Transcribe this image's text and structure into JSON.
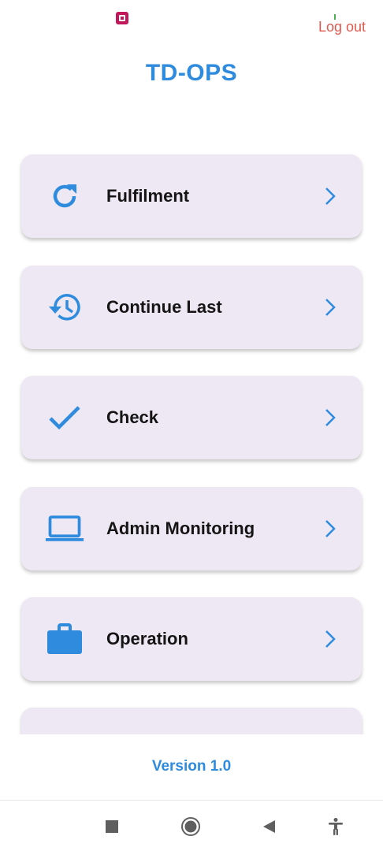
{
  "status_bar": {
    "app_icon": "notification-app-icon"
  },
  "header": {
    "logout_label": "Log out",
    "title": "TD-OPS"
  },
  "menu": {
    "items": [
      {
        "label": "Fulfilment",
        "icon": "refresh-icon"
      },
      {
        "label": "Continue Last",
        "icon": "history-icon"
      },
      {
        "label": "Check",
        "icon": "checkmark-icon"
      },
      {
        "label": "Admin Monitoring",
        "icon": "laptop-icon"
      },
      {
        "label": "Operation",
        "icon": "briefcase-icon"
      },
      {
        "label": "",
        "icon": "scan-icon"
      }
    ]
  },
  "footer": {
    "version": "Version 1.0"
  },
  "navbar": {
    "icons": [
      "recents-icon",
      "home-icon",
      "back-icon",
      "accessibility-icon"
    ]
  },
  "colors": {
    "accent": "#2e8bde",
    "logout": "#e05a4f",
    "card": "#eee8f4"
  }
}
